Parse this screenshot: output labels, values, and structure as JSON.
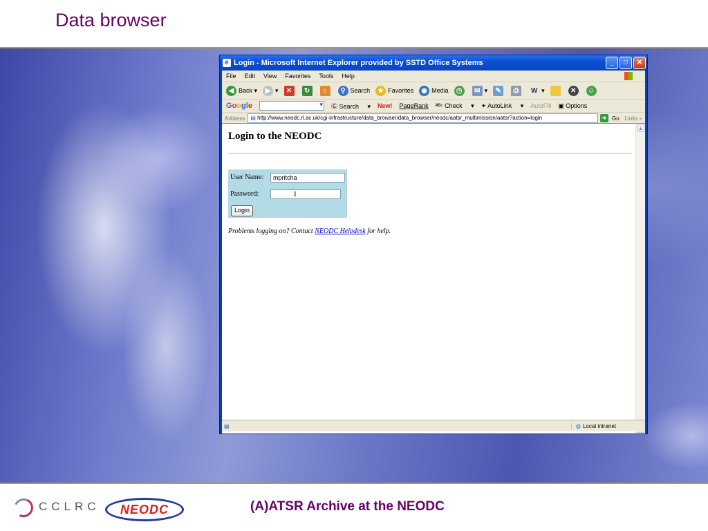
{
  "slide": {
    "title": "Data browser",
    "footer_title": "(A)ATSR Archive at the NEODC",
    "logos": {
      "cclrc": "CCLRC",
      "neodc": "NEODC"
    }
  },
  "browser": {
    "window_title": "Login - Microsoft Internet Explorer provided by SSTD Office Systems",
    "menu": [
      "File",
      "Edit",
      "View",
      "Favorites",
      "Tools",
      "Help"
    ],
    "toolbar": {
      "back": "Back",
      "search": "Search",
      "favorites": "Favorites",
      "media": "Media"
    },
    "google_bar": {
      "logo": "Google",
      "search": "Search",
      "new_badge": "New!",
      "pagerank": "PageRank",
      "check": "Check",
      "autolink": "AutoLink",
      "autofill": "AutoFill",
      "options": "Options"
    },
    "address": {
      "label": "Address",
      "url": "http://www.neodc.rl.ac.uk/cgi-infrastructure/data_browser/data_browser/neodc/aatsr_multimission/aatsr?action=login",
      "go": "Go",
      "links": "Links"
    },
    "status": {
      "zone": "Local intranet"
    }
  },
  "page": {
    "heading": "Login to the NEODC",
    "username_label": "User Name:",
    "username_value": "mpritcha",
    "password_label": "Password:",
    "password_value": "",
    "login_button": "Login",
    "help_prefix": "Problems logging on? Contact",
    "help_link": "NEODC Helpdesk",
    "help_suffix": "for help."
  }
}
